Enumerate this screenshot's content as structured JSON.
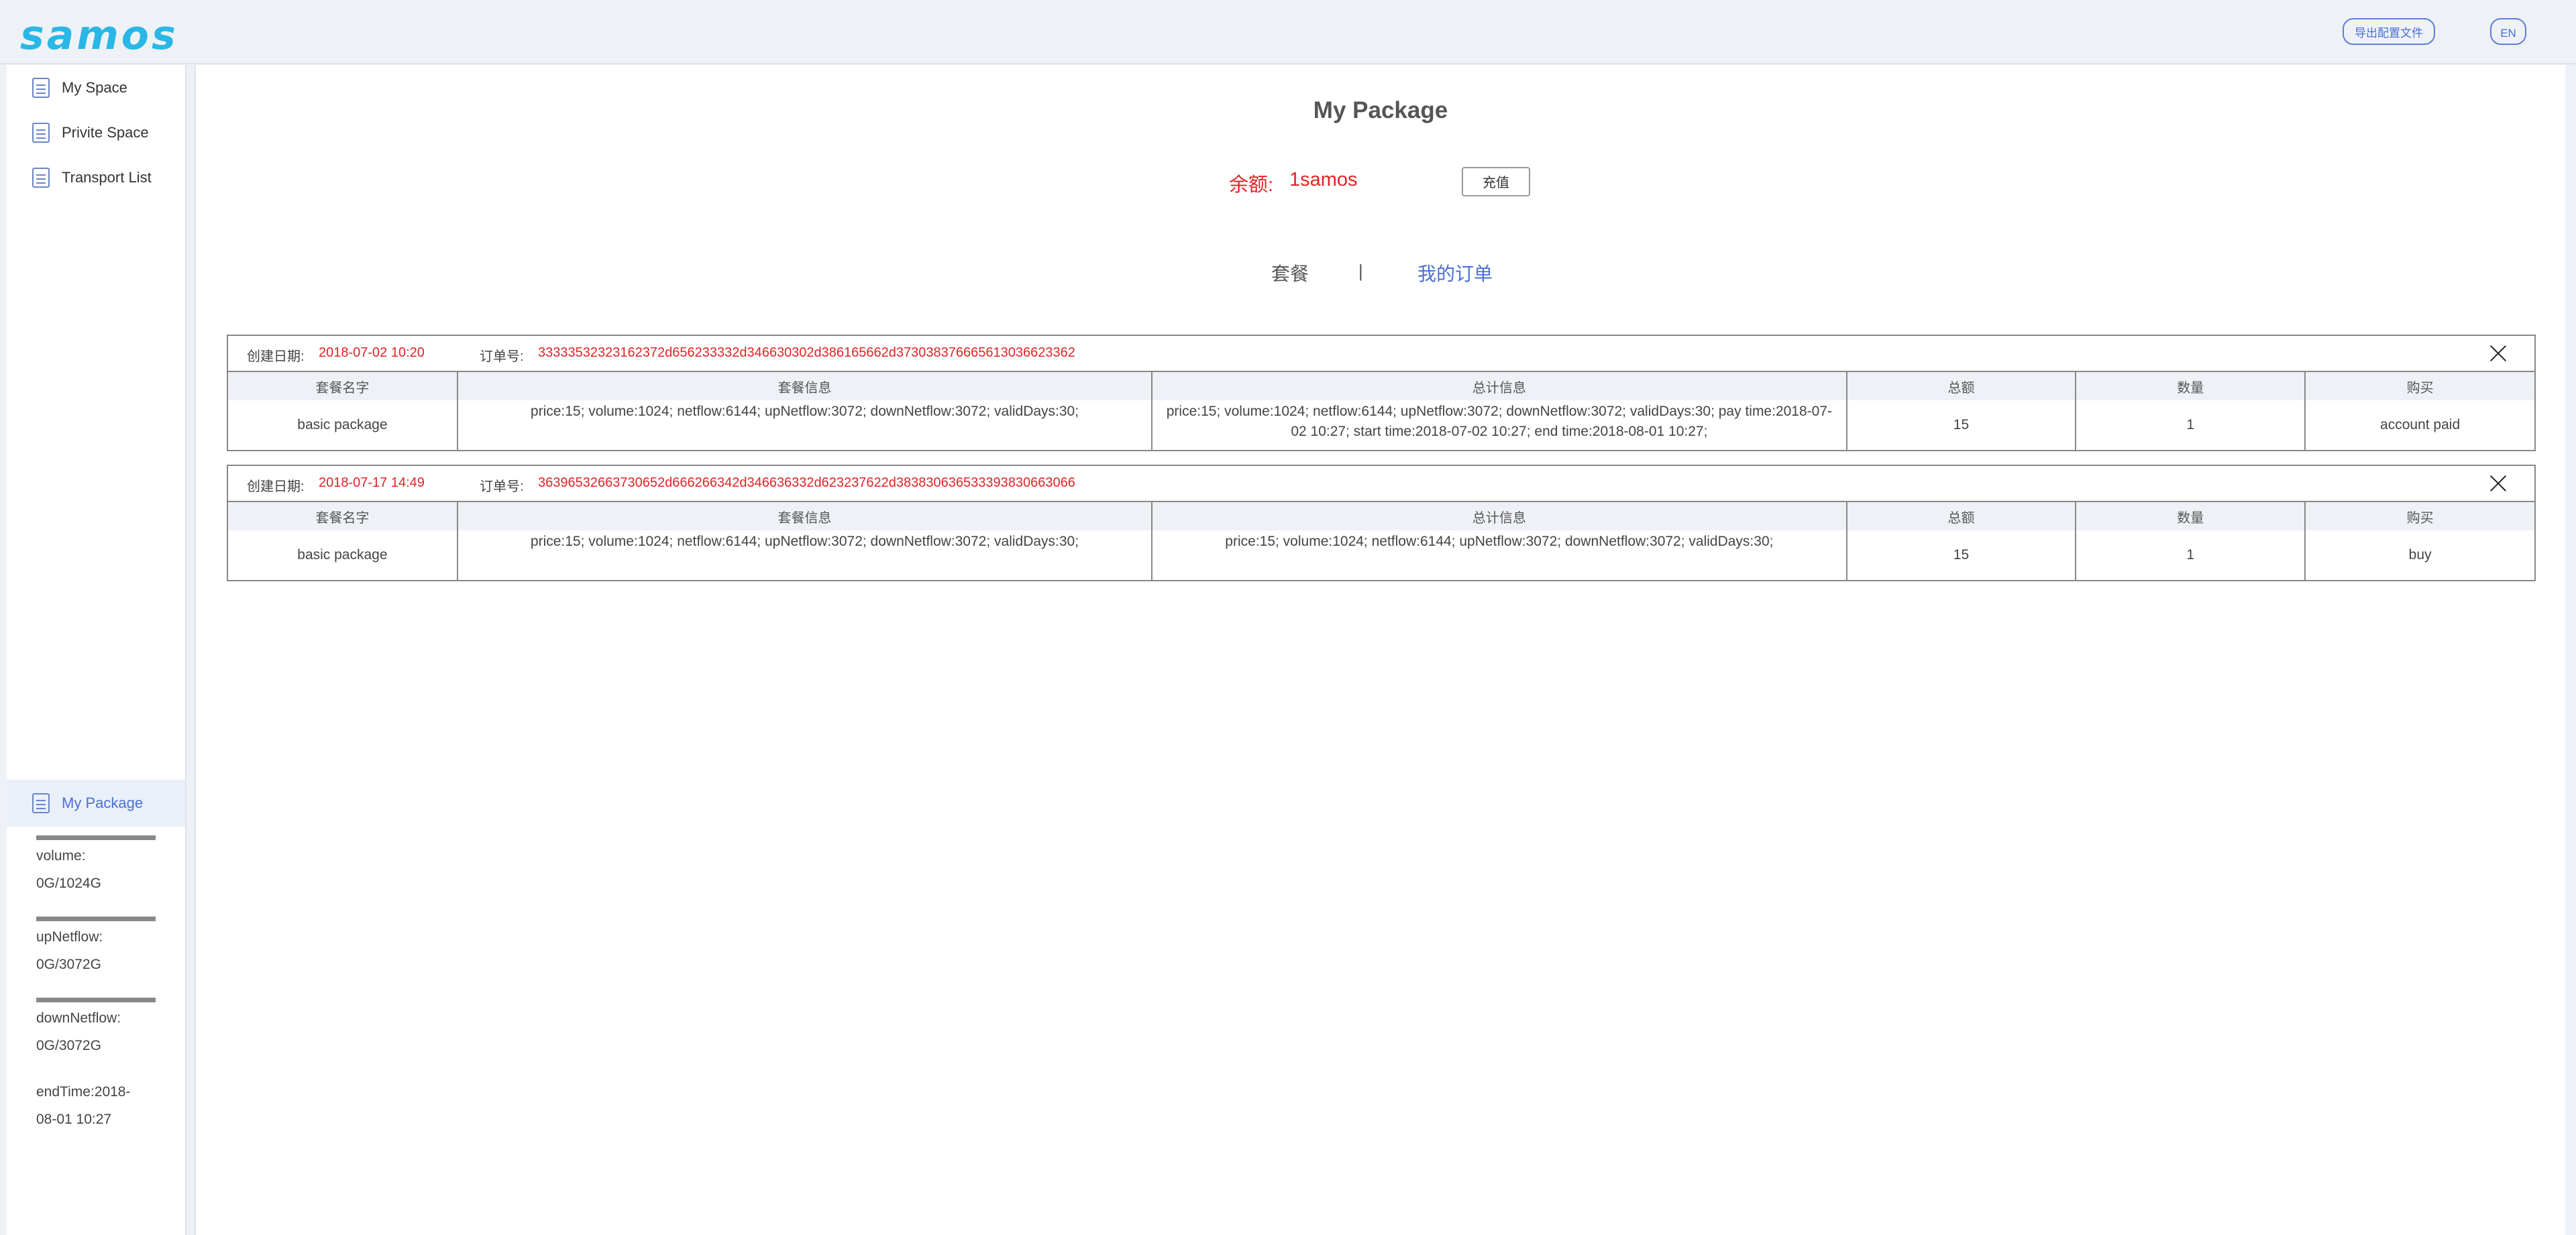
{
  "header": {
    "logo": "samos",
    "export_label": "导出配置文件",
    "lang_label": "EN"
  },
  "sidebar": {
    "items": [
      {
        "label": "My Space",
        "icon": "document-icon"
      },
      {
        "label": "Privite Space",
        "icon": "document-icon"
      },
      {
        "label": "Transport List",
        "icon": "document-icon"
      }
    ],
    "package": {
      "label": "My Package",
      "icon": "document-icon"
    },
    "stats": {
      "volume_label": "volume:",
      "volume_value": "0G/1024G",
      "up_label": "upNetflow:",
      "up_value": "0G/3072G",
      "down_label": "downNetflow:",
      "down_value": "0G/3072G",
      "end_line1": "endTime:2018-",
      "end_line2": "08-01 10:27"
    }
  },
  "main": {
    "title": "My Package",
    "balance_label": "余额:",
    "balance_value": "1samos",
    "recharge_label": "充值",
    "tab_package": "套餐",
    "tab_separator": "|",
    "tab_orders": "我的订单"
  },
  "table_headers": [
    "套餐名字",
    "套餐信息",
    "总计信息",
    "总额",
    "数量",
    "购买"
  ],
  "orders": [
    {
      "date_label": "创建日期:",
      "date": "2018-07-02 10:20",
      "no_label": "订单号:",
      "no": "33333532323162372d656233332d346630302d386165662d37303837666561303662336​2",
      "name": "basic package",
      "info": "price:15; volume:1024; netflow:6144; upNetflow:3072; downNetflow:3072; validDays:30;",
      "total_info": "price:15; volume:1024; netflow:6144; upNetflow:3072; downNetflow:3072; validDays:30; pay time:2018-07-02 10:27; start time:2018-07-02 10:27; end time:2018-08-01 10:27;",
      "amount": "15",
      "quantity": "1",
      "buy": "account paid"
    },
    {
      "date_label": "创建日期:",
      "date": "2018-07-17 14:49",
      "no_label": "订单号:",
      "no": "36396532663730652d666266342d346636332d623237622d38383063653339383066306​6",
      "name": "basic package",
      "info": "price:15; volume:1024; netflow:6144; upNetflow:3072; downNetflow:3072; validDays:30;",
      "total_info": "price:15; volume:1024; netflow:6144; upNetflow:3072; downNetflow:3072; validDays:30;",
      "amount": "15",
      "quantity": "1",
      "buy": "buy"
    }
  ],
  "colors": {
    "accent": "#4a6fd0",
    "logo": "#2ab7e6",
    "alert": "#e02424"
  }
}
